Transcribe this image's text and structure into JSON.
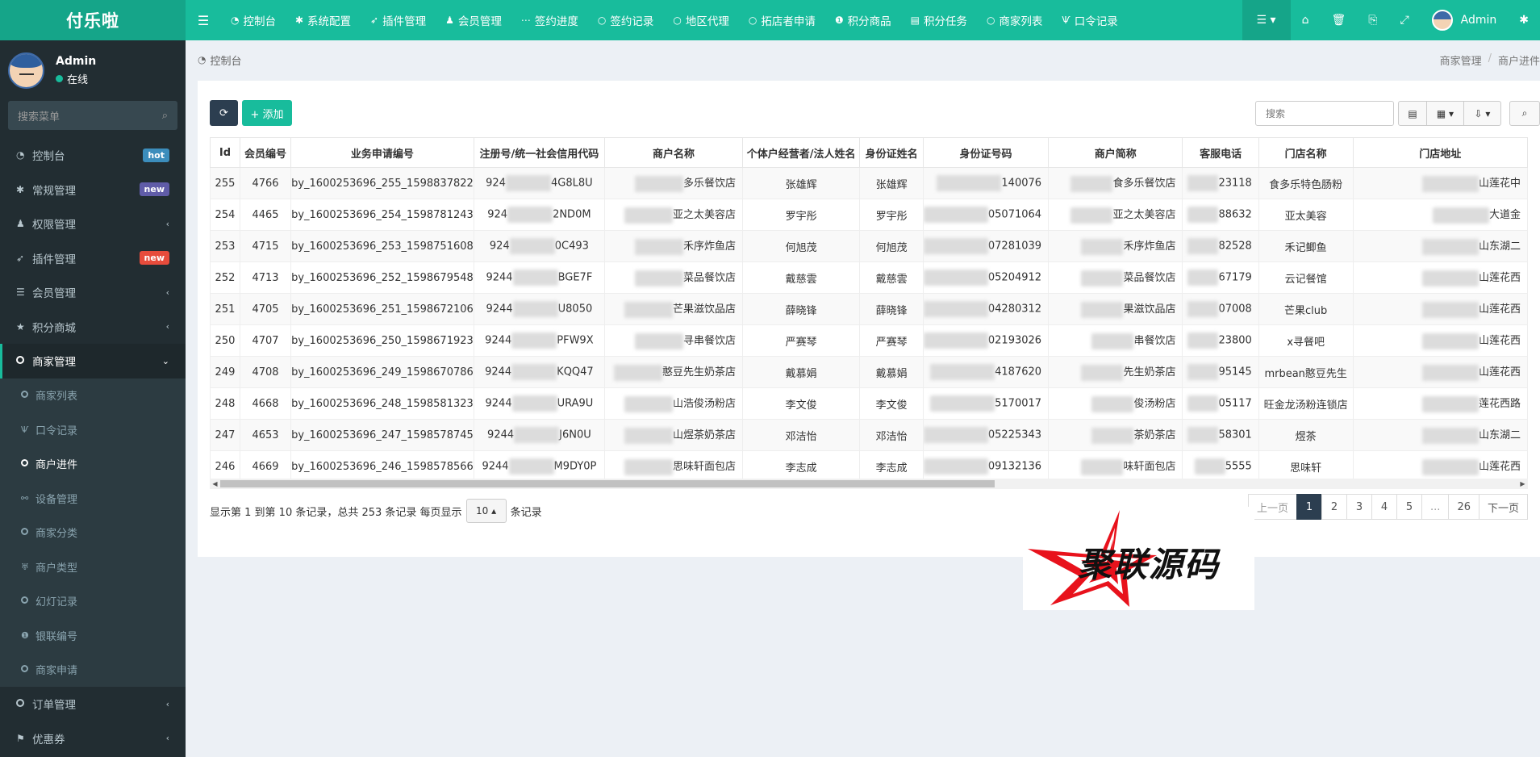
{
  "brand": "付乐啦",
  "topnav": [
    {
      "icon": "dashboard-icon",
      "glyph": "◔",
      "label": "控制台"
    },
    {
      "icon": "gear-icon",
      "glyph": "✱",
      "label": "系统配置"
    },
    {
      "icon": "rocket-icon",
      "glyph": "➶",
      "label": "插件管理"
    },
    {
      "icon": "user-icon",
      "glyph": "♟",
      "label": "会员管理"
    },
    {
      "icon": "ellipsis-icon",
      "glyph": "⋯",
      "label": "签约进度"
    },
    {
      "icon": "circle-icon",
      "glyph": "○",
      "label": "签约记录"
    },
    {
      "icon": "circle-icon",
      "glyph": "○",
      "label": "地区代理"
    },
    {
      "icon": "circle-icon",
      "glyph": "○",
      "label": "拓店者申请"
    },
    {
      "icon": "coin-icon",
      "glyph": "❶",
      "label": "积分商品"
    },
    {
      "icon": "list-icon",
      "glyph": "▤",
      "label": "积分任务"
    },
    {
      "icon": "circle-icon",
      "glyph": "○",
      "label": "商家列表"
    },
    {
      "icon": "fork-icon",
      "glyph": "Ѱ",
      "label": "口令记录"
    }
  ],
  "top_right": {
    "admin_label": "Admin"
  },
  "user": {
    "name": "Admin",
    "status": "在线"
  },
  "sidebar_search_placeholder": "搜索菜单",
  "menu": [
    {
      "label": "控制台",
      "glyph": "◔",
      "icon": "dashboard-icon",
      "badge": "hot",
      "badge_class": "hot"
    },
    {
      "label": "常规管理",
      "glyph": "✱",
      "icon": "cogs-icon",
      "badge": "new",
      "badge_class": "new1"
    },
    {
      "label": "权限管理",
      "glyph": "♟",
      "icon": "group-icon",
      "arrow": "‹"
    },
    {
      "label": "插件管理",
      "glyph": "➶",
      "icon": "rocket-icon",
      "badge": "new",
      "badge_class": "new2"
    },
    {
      "label": "会员管理",
      "glyph": "☰",
      "icon": "list-icon",
      "arrow": "‹"
    },
    {
      "label": "积分商城",
      "glyph": "★",
      "icon": "star-icon",
      "arrow": "‹"
    }
  ],
  "active_menu": {
    "label": "商家管理",
    "arrow": "⌄"
  },
  "submenu": [
    {
      "label": "商家列表",
      "glyph": "○",
      "icon": "circle-icon"
    },
    {
      "label": "口令记录",
      "glyph": "Ѱ",
      "icon": "fork-icon"
    },
    {
      "label": "商户进件",
      "glyph": "○",
      "icon": "circle-icon",
      "current": true
    },
    {
      "label": "设备管理",
      "glyph": "⚯",
      "icon": "device-icon"
    },
    {
      "label": "商家分类",
      "glyph": "○",
      "icon": "circle-icon"
    },
    {
      "label": "商户类型",
      "glyph": "♅",
      "icon": "type-icon"
    },
    {
      "label": "幻灯记录",
      "glyph": "○",
      "icon": "circle-icon"
    },
    {
      "label": "银联编号",
      "glyph": "❶",
      "icon": "coin-icon"
    },
    {
      "label": "商家申请",
      "glyph": "○",
      "icon": "circle-icon"
    }
  ],
  "menu_bottom": [
    {
      "label": "订单管理",
      "glyph": "○",
      "icon": "circle-icon",
      "arrow": "‹"
    },
    {
      "label": "优惠券",
      "glyph": "⚑",
      "icon": "bookmark-icon",
      "arrow": "‹"
    }
  ],
  "page_title": "控制台",
  "breadcrumb": [
    "商家管理",
    "商户进件"
  ],
  "toolbar": {
    "add_label": "+ 添加",
    "search_placeholder": "搜索"
  },
  "table": {
    "columns": [
      "Id",
      "会员编号",
      "业务申请编号",
      "注册号/统一社会信用代码",
      "商户名称",
      "个体户经营者/法人姓名",
      "身份证姓名",
      "身份证号码",
      "商户简称",
      "客服电话",
      "门店名称",
      "门店地址"
    ],
    "rows": [
      {
        "id": "255",
        "member": "4766",
        "app": "by_1600253696_255_1598837822",
        "reg_pre": "924",
        "reg_suf": "4G8L8U",
        "name": "多乐餐饮店",
        "legal": "张雄辉",
        "idname": "张雄辉",
        "idno": "140076",
        "short": "食多乐餐饮店",
        "phone": "23118",
        "store": "食多乐特色肠粉",
        "addr": "山莲花中"
      },
      {
        "id": "254",
        "member": "4465",
        "app": "by_1600253696_254_1598781243",
        "reg_pre": "924",
        "reg_suf": "2ND0M",
        "name": "亚之太美容店",
        "legal": "罗宇彤",
        "idname": "罗宇彤",
        "idno": "05071064",
        "short": "亚之太美容店",
        "phone": "88632",
        "store": "亚太美容",
        "addr": "大道金"
      },
      {
        "id": "253",
        "member": "4715",
        "app": "by_1600253696_253_1598751608",
        "reg_pre": "924",
        "reg_suf": "0C493",
        "name": "禾序炸鱼店",
        "legal": "何旭茂",
        "idname": "何旭茂",
        "idno": "07281039",
        "short": "禾序炸鱼店",
        "phone": "82528",
        "store": "禾记鲫鱼",
        "addr": "山东湖二"
      },
      {
        "id": "252",
        "member": "4713",
        "app": "by_1600253696_252_1598679548",
        "reg_pre": "9244",
        "reg_suf": "BGE7F",
        "name": "菜品餐饮店",
        "legal": "戴慈雲",
        "idname": "戴慈雲",
        "idno": "05204912",
        "short": "菜品餐饮店",
        "phone": "67179",
        "store": "云记餐馆",
        "addr": "山莲花西"
      },
      {
        "id": "251",
        "member": "4705",
        "app": "by_1600253696_251_1598672106",
        "reg_pre": "9244",
        "reg_suf": "U8050",
        "name": "芒果滋饮品店",
        "legal": "薛晓锋",
        "idname": "薛晓锋",
        "idno": "04280312",
        "short": "果滋饮品店",
        "phone": "07008",
        "store": "芒果club",
        "addr": "山莲花西"
      },
      {
        "id": "250",
        "member": "4707",
        "app": "by_1600253696_250_1598671923",
        "reg_pre": "9244",
        "reg_suf": "PFW9X",
        "name": "寻串餐饮店",
        "legal": "严赛琴",
        "idname": "严赛琴",
        "idno": "02193026",
        "short": "串餐饮店",
        "phone": "23800",
        "store": "x寻餐吧",
        "addr": "山莲花西"
      },
      {
        "id": "249",
        "member": "4708",
        "app": "by_1600253696_249_1598670786",
        "reg_pre": "9244",
        "reg_suf": "KQQ47",
        "name": "憨豆先生奶茶店",
        "legal": "戴慕娟",
        "idname": "戴慕娟",
        "idno": "4187620",
        "short": "先生奶茶店",
        "phone": "95145",
        "store": "mrbean憨豆先生",
        "addr": "山莲花西"
      },
      {
        "id": "248",
        "member": "4668",
        "app": "by_1600253696_248_1598581323",
        "reg_pre": "9244",
        "reg_suf": "URA9U",
        "name": "山浩俊汤粉店",
        "legal": "李文俊",
        "idname": "李文俊",
        "idno": "5170017",
        "short": "俊汤粉店",
        "phone": "05117",
        "store": "旺金龙汤粉连锁店",
        "addr": "莲花西路"
      },
      {
        "id": "247",
        "member": "4653",
        "app": "by_1600253696_247_1598578745",
        "reg_pre": "9244",
        "reg_suf": "J6N0U",
        "name": "山煜茶奶茶店",
        "legal": "邓洁怡",
        "idname": "邓洁怡",
        "idno": "05225343",
        "short": "茶奶茶店",
        "phone": "58301",
        "store": "煜茶",
        "addr": "山东湖二"
      },
      {
        "id": "246",
        "member": "4669",
        "app": "by_1600253696_246_1598578566",
        "reg_pre": "9244",
        "reg_suf": "M9DY0P",
        "name": "思味轩面包店",
        "legal": "李志成",
        "idname": "李志成",
        "idno": "09132136",
        "short": "味轩面包店",
        "phone": "5555",
        "store": "思味轩",
        "addr": "山莲花西"
      }
    ]
  },
  "footer": {
    "info_pre": "显示第 1 到第 10 条记录，总共 253 条记录 每页显示",
    "page_size": "10 ▴",
    "info_post": "条记录"
  },
  "pagination": [
    "上一页",
    "1",
    "2",
    "3",
    "4",
    "5",
    "...",
    "26",
    "下一页"
  ],
  "watermark": {
    "text": "聚联源码"
  },
  "colors": {
    "primary": "#18bc9c",
    "dark": "#2c3e50",
    "sidebar": "#222d32",
    "watermark_red": "#e8121c"
  }
}
